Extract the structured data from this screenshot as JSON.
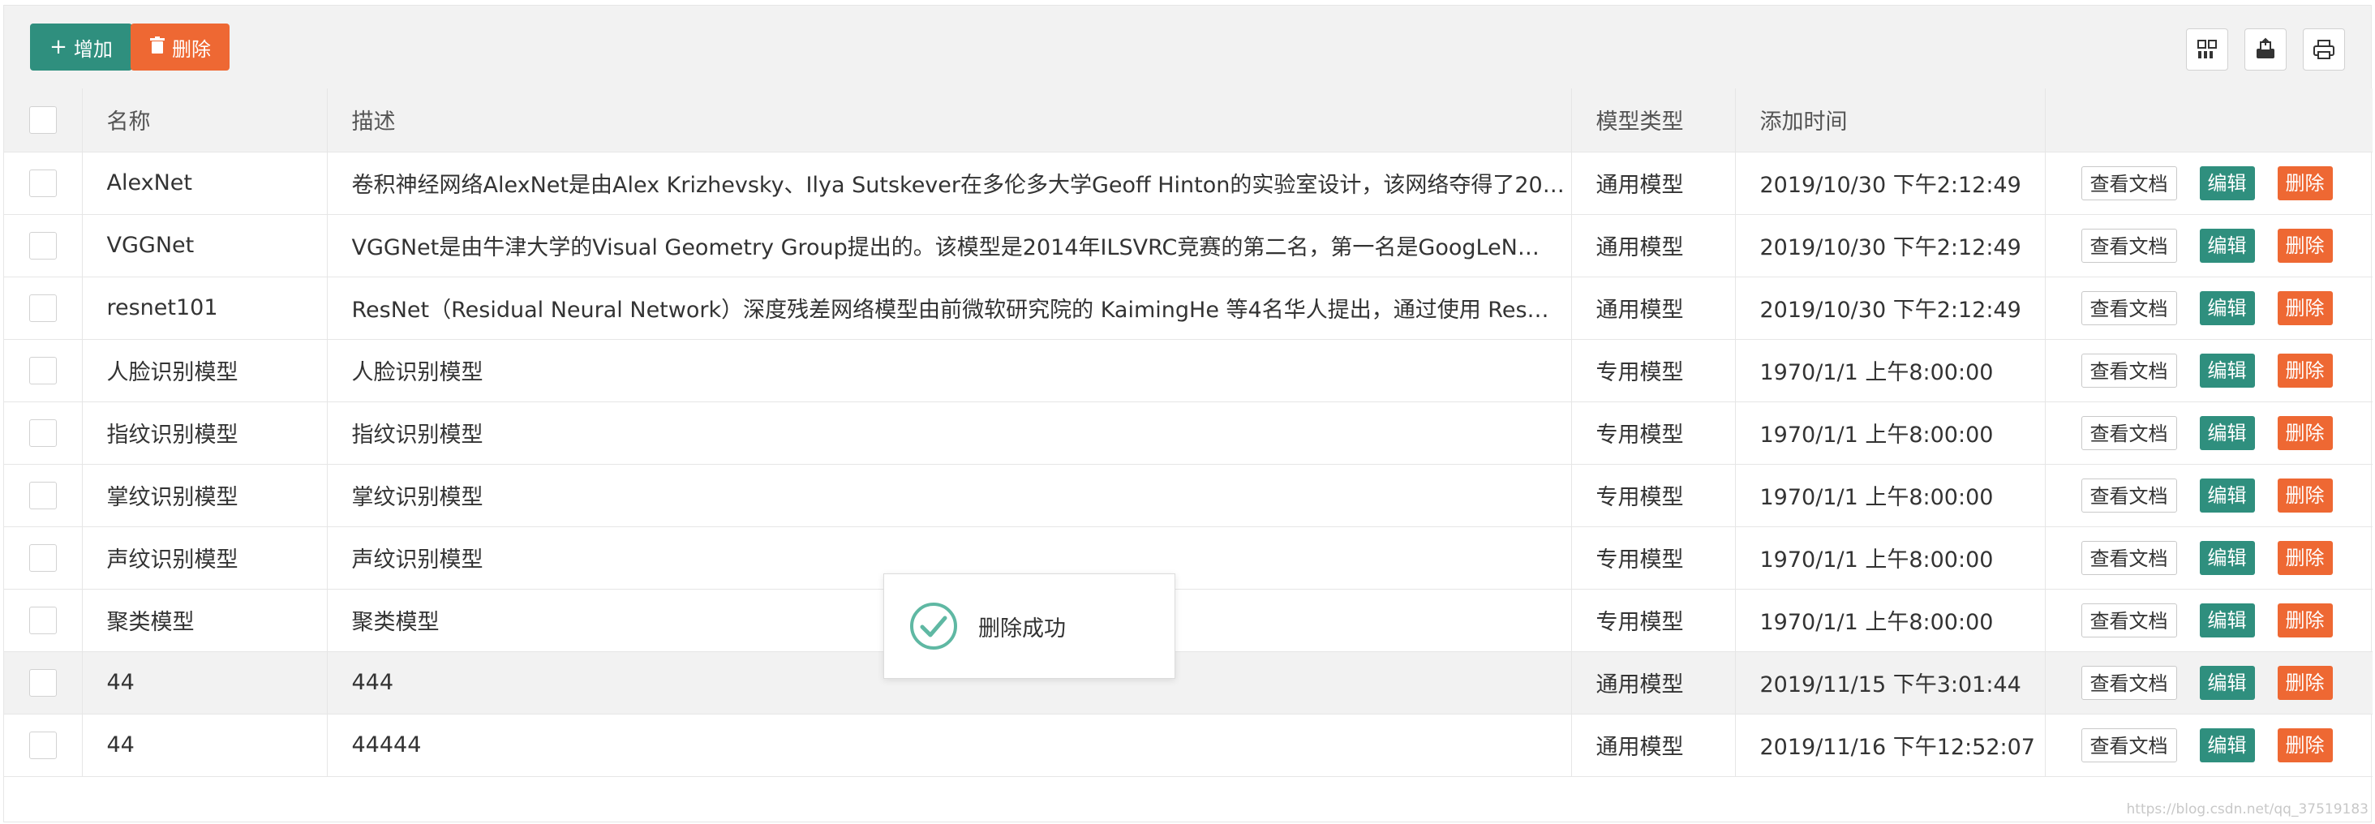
{
  "toolbar": {
    "add_label": "增加",
    "delete_label": "删除",
    "add_color": "#2f8f7e",
    "delete_color": "#ee6833",
    "icons": [
      "columns-icon",
      "export-icon",
      "print-icon"
    ]
  },
  "table": {
    "headers": [
      "名称",
      "描述",
      "模型类型",
      "添加时间"
    ],
    "rows": [
      {
        "name": "AlexNet",
        "desc": "卷积神经网络AlexNet是由Alex Krizhevsky、Ilya Sutskever在多伦多大学Geoff Hinton的实验室设计，该网络夺得了20…",
        "type": "通用模型",
        "time": "2019/10/30 下午2:12:49"
      },
      {
        "name": "VGGNet",
        "desc": "VGGNet是由牛津大学的Visual Geometry Group提出的。该模型是2014年ILSVRC竞赛的第二名，第一名是GoogLeN…",
        "type": "通用模型",
        "time": "2019/10/30 下午2:12:49"
      },
      {
        "name": "resnet101",
        "desc": "ResNet（Residual Neural Network）深度残差网络模型由前微软研究院的 KaimingHe 等4名华人提出，通过使用 Res…",
        "type": "通用模型",
        "time": "2019/10/30 下午2:12:49"
      },
      {
        "name": "人脸识别模型",
        "desc": "人脸识别模型",
        "type": "专用模型",
        "time": "1970/1/1 上午8:00:00"
      },
      {
        "name": "指纹识别模型",
        "desc": "指纹识别模型",
        "type": "专用模型",
        "time": "1970/1/1 上午8:00:00"
      },
      {
        "name": "掌纹识别模型",
        "desc": "掌纹识别模型",
        "type": "专用模型",
        "time": "1970/1/1 上午8:00:00"
      },
      {
        "name": "声纹识别模型",
        "desc": "声纹识别模型",
        "type": "专用模型",
        "time": "1970/1/1 上午8:00:00"
      },
      {
        "name": "聚类模型",
        "desc": "聚类模型",
        "type": "专用模型",
        "time": "1970/1/1 上午8:00:00"
      },
      {
        "name": "44",
        "desc": "444",
        "type": "通用模型",
        "time": "2019/11/15 下午3:01:44"
      },
      {
        "name": "44",
        "desc": "44444",
        "type": "通用模型",
        "time": "2019/11/16 下午12:52:07"
      }
    ],
    "row_actions": {
      "view_doc": "查看文档",
      "edit": "编辑",
      "delete": "删除"
    }
  },
  "toast": {
    "message": "删除成功",
    "icon": "check-circle-icon",
    "icon_color": "#5fb8a3"
  },
  "watermark": "https://blog.csdn.net/qq_37519183"
}
